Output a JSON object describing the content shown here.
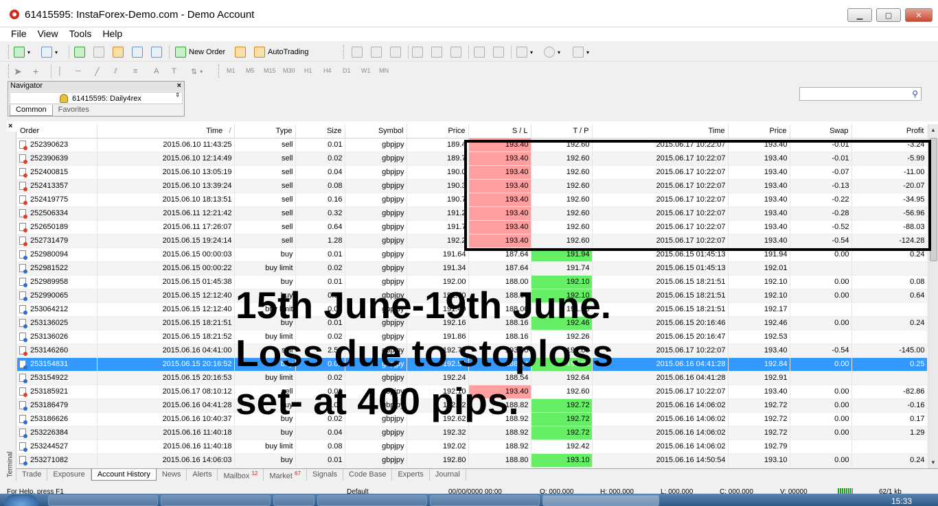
{
  "window": {
    "title": "61415595: InstaForex-Demo.com - Demo Account",
    "minimize": "▁",
    "maximize": "▢",
    "close": "✕"
  },
  "menu": [
    "File",
    "View",
    "Tools",
    "Help"
  ],
  "toolbar": {
    "new_order": "New Order",
    "autotrading": "AutoTrading",
    "timeframes": [
      "M1",
      "M5",
      "M15",
      "M30",
      "H1",
      "H4",
      "D1",
      "W1",
      "MN"
    ],
    "search_placeholder": ""
  },
  "navigator": {
    "title": "Navigator",
    "account": "61415595: Daily4rex",
    "tabs": [
      "Common",
      "Favorites"
    ]
  },
  "table": {
    "columns": [
      "Order",
      "Time",
      "Type",
      "Size",
      "Symbol",
      "Price",
      "S / L",
      "T / P",
      "Time",
      "Price",
      "Swap",
      "Profit"
    ],
    "sort_indicator": "/",
    "rows": [
      {
        "order": "252390623",
        "time": "2015.06.10 11:43:25",
        "type": "sell",
        "size": "0.01",
        "symbol": "gbpjpy",
        "price": "189.4",
        "sl": "193.40",
        "tp": "192.60",
        "ctime": "2015.06.17 10:22:07",
        "cprice": "193.40",
        "swap": "-0.01",
        "profit": "-3.24",
        "sl_hit": true,
        "tp_hit": false,
        "dir": "sell"
      },
      {
        "order": "252390639",
        "time": "2015.06.10 12:14:49",
        "type": "sell",
        "size": "0.02",
        "symbol": "gbpjpy",
        "price": "189.7",
        "sl": "193.40",
        "tp": "192.60",
        "ctime": "2015.06.17 10:22:07",
        "cprice": "193.40",
        "swap": "-0.01",
        "profit": "-5.99",
        "sl_hit": true,
        "tp_hit": false,
        "dir": "sell"
      },
      {
        "order": "252400815",
        "time": "2015.06.10 13:05:19",
        "type": "sell",
        "size": "0.04",
        "symbol": "gbpjpy",
        "price": "190.0",
        "sl": "193.40",
        "tp": "192.60",
        "ctime": "2015.06.17 10:22:07",
        "cprice": "193.40",
        "swap": "-0.07",
        "profit": "-11.00",
        "sl_hit": true,
        "tp_hit": false,
        "dir": "sell"
      },
      {
        "order": "252413357",
        "time": "2015.06.10 13:39:24",
        "type": "sell",
        "size": "0.08",
        "symbol": "gbpjpy",
        "price": "190.3",
        "sl": "193.40",
        "tp": "192.60",
        "ctime": "2015.06.17 10:22:07",
        "cprice": "193.40",
        "swap": "-0.13",
        "profit": "-20.07",
        "sl_hit": true,
        "tp_hit": false,
        "dir": "sell"
      },
      {
        "order": "252419775",
        "time": "2015.06.10 18:13:51",
        "type": "sell",
        "size": "0.16",
        "symbol": "gbpjpy",
        "price": "190.7",
        "sl": "193.40",
        "tp": "192.60",
        "ctime": "2015.06.17 10:22:07",
        "cprice": "193.40",
        "swap": "-0.22",
        "profit": "-34.95",
        "sl_hit": true,
        "tp_hit": false,
        "dir": "sell"
      },
      {
        "order": "252506334",
        "time": "2015.06.11 12:21:42",
        "type": "sell",
        "size": "0.32",
        "symbol": "gbpjpy",
        "price": "191.2",
        "sl": "193.40",
        "tp": "192.60",
        "ctime": "2015.06.17 10:22:07",
        "cprice": "193.40",
        "swap": "-0.28",
        "profit": "-56.96",
        "sl_hit": true,
        "tp_hit": false,
        "dir": "sell"
      },
      {
        "order": "252650189",
        "time": "2015.06.11 17:26:07",
        "type": "sell",
        "size": "0.64",
        "symbol": "gbpjpy",
        "price": "191.7",
        "sl": "193.40",
        "tp": "192.60",
        "ctime": "2015.06.17 10:22:07",
        "cprice": "193.40",
        "swap": "-0.52",
        "profit": "-88.03",
        "sl_hit": true,
        "tp_hit": false,
        "dir": "sell"
      },
      {
        "order": "252731479",
        "time": "2015.06.15 19:24:14",
        "type": "sell",
        "size": "1.28",
        "symbol": "gbpjpy",
        "price": "192.2",
        "sl": "193.40",
        "tp": "192.60",
        "ctime": "2015.06.17 10:22:07",
        "cprice": "193.40",
        "swap": "-0.54",
        "profit": "-124.28",
        "sl_hit": true,
        "tp_hit": false,
        "dir": "sell"
      },
      {
        "order": "252980094",
        "time": "2015.06.15 00:00:03",
        "type": "buy",
        "size": "0.01",
        "symbol": "gbpjpy",
        "price": "191.64",
        "sl": "187.64",
        "tp": "191.94",
        "ctime": "2015.06.15 01:45:13",
        "cprice": "191.94",
        "swap": "0.00",
        "profit": "0.24",
        "sl_hit": false,
        "tp_hit": true,
        "dir": "buy"
      },
      {
        "order": "252981522",
        "time": "2015.06.15 00:00:22",
        "type": "buy limit",
        "size": "0.02",
        "symbol": "gbpjpy",
        "price": "191.34",
        "sl": "187.64",
        "tp": "191.74",
        "ctime": "2015.06.15 01:45:13",
        "cprice": "192.01",
        "swap": "",
        "profit": "",
        "sl_hit": false,
        "tp_hit": false,
        "dir": "buy"
      },
      {
        "order": "252989958",
        "time": "2015.06.15 01:45:38",
        "type": "buy",
        "size": "0.01",
        "symbol": "gbpjpy",
        "price": "192.00",
        "sl": "188.00",
        "tp": "192.10",
        "ctime": "2015.06.15 18:21:51",
        "cprice": "192.10",
        "swap": "0.00",
        "profit": "0.08",
        "sl_hit": false,
        "tp_hit": true,
        "dir": "buy"
      },
      {
        "order": "252990065",
        "time": "2015.06.15 12:12:40",
        "type": "buy",
        "size": "0.02",
        "symbol": "gbpjpy",
        "price": "191.70",
        "sl": "188.00",
        "tp": "192.10",
        "ctime": "2015.06.15 18:21:51",
        "cprice": "192.10",
        "swap": "0.00",
        "profit": "0.64",
        "sl_hit": false,
        "tp_hit": true,
        "dir": "buy"
      },
      {
        "order": "253064212",
        "time": "2015.06.15 12:12:40",
        "type": "buy limit",
        "size": "0.04",
        "symbol": "gbpjpy",
        "price": "191.40",
        "sl": "188.00",
        "tp": "191.80",
        "ctime": "2015.06.15 18:21:51",
        "cprice": "192.17",
        "swap": "",
        "profit": "",
        "sl_hit": false,
        "tp_hit": false,
        "dir": "buy"
      },
      {
        "order": "253136025",
        "time": "2015.06.15 18:21:51",
        "type": "buy",
        "size": "0.01",
        "symbol": "gbpjpy",
        "price": "192.16",
        "sl": "188.16",
        "tp": "192.46",
        "ctime": "2015.06.15 20:16:46",
        "cprice": "192.46",
        "swap": "0.00",
        "profit": "0.24",
        "sl_hit": false,
        "tp_hit": true,
        "dir": "buy"
      },
      {
        "order": "253136026",
        "time": "2015.06.15 18:21:52",
        "type": "buy limit",
        "size": "0.02",
        "symbol": "gbpjpy",
        "price": "191.86",
        "sl": "188.16",
        "tp": "192.26",
        "ctime": "2015.06.15 20:16:47",
        "cprice": "192.53",
        "swap": "",
        "profit": "",
        "sl_hit": false,
        "tp_hit": false,
        "dir": "buy"
      },
      {
        "order": "253146260",
        "time": "2015.06.16 04:41:00",
        "type": "sell",
        "size": "2.56",
        "symbol": "gbpjpy",
        "price": "192.70",
        "sl": "193.40",
        "tp": "192.60",
        "ctime": "2015.06.17 10:22:07",
        "cprice": "193.40",
        "swap": "-0.54",
        "profit": "-145.00",
        "sl_hit": false,
        "tp_hit": false,
        "dir": "sell"
      },
      {
        "order": "253154831",
        "time": "2015.06.15 20:16:52",
        "type": "buy",
        "size": "0.01",
        "symbol": "gbpjpy",
        "price": "192.54",
        "sl": "188.54",
        "tp": "192.84",
        "ctime": "2015.06.16 04:41:28",
        "cprice": "192.84",
        "swap": "0.00",
        "profit": "0.25",
        "sl_hit": false,
        "tp_hit": true,
        "dir": "buy",
        "selected": true
      },
      {
        "order": "253154922",
        "time": "2015.06.15 20:16:53",
        "type": "buy limit",
        "size": "0.02",
        "symbol": "gbpjpy",
        "price": "192.24",
        "sl": "188.54",
        "tp": "192.64",
        "ctime": "2015.06.16 04:41:28",
        "cprice": "192.91",
        "swap": "",
        "profit": "",
        "sl_hit": false,
        "tp_hit": false,
        "dir": "buy"
      },
      {
        "order": "253185921",
        "time": "2015.06.17 08:10:12",
        "type": "sell",
        "size": "0.01",
        "symbol": "gbpjpy",
        "price": "192.10",
        "sl": "193.40",
        "tp": "192.60",
        "ctime": "2015.06.17 10:22:07",
        "cprice": "193.40",
        "swap": "0.00",
        "profit": "-82.86",
        "sl_hit": true,
        "tp_hit": false,
        "dir": "sell"
      },
      {
        "order": "253186479",
        "time": "2015.06.16 04:41:28",
        "type": "buy",
        "size": "0.01",
        "symbol": "gbpjpy",
        "price": "192.82",
        "sl": "188.82",
        "tp": "192.72",
        "ctime": "2015.06.16 14:06:02",
        "cprice": "192.72",
        "swap": "0.00",
        "profit": "-0.16",
        "sl_hit": false,
        "tp_hit": true,
        "dir": "buy"
      },
      {
        "order": "253186626",
        "time": "2015.06.16 10:40:37",
        "type": "buy",
        "size": "0.02",
        "symbol": "gbpjpy",
        "price": "192.62",
        "sl": "188.92",
        "tp": "192.72",
        "ctime": "2015.06.16 14:06:02",
        "cprice": "192.72",
        "swap": "0.00",
        "profit": "0.17",
        "sl_hit": false,
        "tp_hit": true,
        "dir": "buy"
      },
      {
        "order": "253226384",
        "time": "2015.06.16 11:40:18",
        "type": "buy",
        "size": "0.04",
        "symbol": "gbpjpy",
        "price": "192.32",
        "sl": "188.92",
        "tp": "192.72",
        "ctime": "2015.06.16 14:06:02",
        "cprice": "192.72",
        "swap": "0.00",
        "profit": "1.29",
        "sl_hit": false,
        "tp_hit": true,
        "dir": "buy"
      },
      {
        "order": "253244527",
        "time": "2015.06.16 11:40:18",
        "type": "buy limit",
        "size": "0.08",
        "symbol": "gbpjpy",
        "price": "192.02",
        "sl": "188.92",
        "tp": "192.42",
        "ctime": "2015.06.16 14:06:02",
        "cprice": "192.79",
        "swap": "",
        "profit": "",
        "sl_hit": false,
        "tp_hit": false,
        "dir": "buy"
      },
      {
        "order": "253271082",
        "time": "2015.06.16 14:06:03",
        "type": "buy",
        "size": "0.01",
        "symbol": "gbpjpy",
        "price": "192.80",
        "sl": "188.80",
        "tp": "193.10",
        "ctime": "2015.06.16 14:50:54",
        "cprice": "193.10",
        "swap": "0.00",
        "profit": "0.24",
        "sl_hit": false,
        "tp_hit": true,
        "dir": "buy"
      }
    ]
  },
  "annotation": "15th June-19th June. Loss due to stoploss set- at 400 pips.",
  "terminal": {
    "side_label": "Terminal",
    "tabs": [
      {
        "label": "Trade",
        "badge": ""
      },
      {
        "label": "Exposure",
        "badge": ""
      },
      {
        "label": "Account History",
        "badge": "",
        "active": true
      },
      {
        "label": "News",
        "badge": ""
      },
      {
        "label": "Alerts",
        "badge": ""
      },
      {
        "label": "Mailbox",
        "badge": "12"
      },
      {
        "label": "Market",
        "badge": "67"
      },
      {
        "label": "Signals",
        "badge": ""
      },
      {
        "label": "Code Base",
        "badge": ""
      },
      {
        "label": "Experts",
        "badge": ""
      },
      {
        "label": "Journal",
        "badge": ""
      }
    ]
  },
  "status": {
    "help": "For Help, press F1",
    "profile": "Default",
    "datetime": "00/00/0000 00:00",
    "o": "O: 000.000",
    "h": "H: 000.000",
    "l": "L: 000.000",
    "c": "C: 000.000",
    "v": "V: 00000",
    "traffic": "62/1 kb"
  },
  "taskbar": {
    "clock": "15:33"
  },
  "colors": {
    "sl_hit": "#ff9f9f",
    "tp_hit": "#66ee66",
    "selected_row": "#3399ff"
  }
}
